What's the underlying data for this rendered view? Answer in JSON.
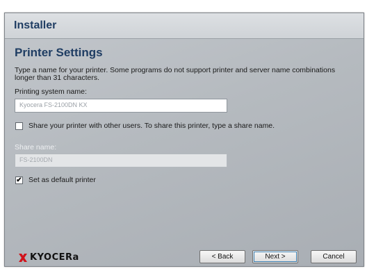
{
  "window": {
    "title": "Installer"
  },
  "page": {
    "heading": "Printer Settings",
    "description": "Type a name for your printer. Some programs do not support printer and server name combinations longer than 31 characters.",
    "printing_system_name_label": "Printing system name:",
    "printing_system_name_value": "Kyocera FS-2100DN KX",
    "share_checkbox_label": "Share your printer with other users. To share this printer, type a share name.",
    "share_checked": false,
    "share_name_label": "Share name:",
    "share_name_value": "FS-2100DN",
    "default_checkbox_label": "Set as default printer",
    "default_checked": true
  },
  "footer": {
    "logo_text": "KYOCERa",
    "back_label": "< Back",
    "next_label": "Next >",
    "cancel_label": "Cancel"
  },
  "colors": {
    "heading": "#1f3d63",
    "logo_red": "#d0131b"
  }
}
